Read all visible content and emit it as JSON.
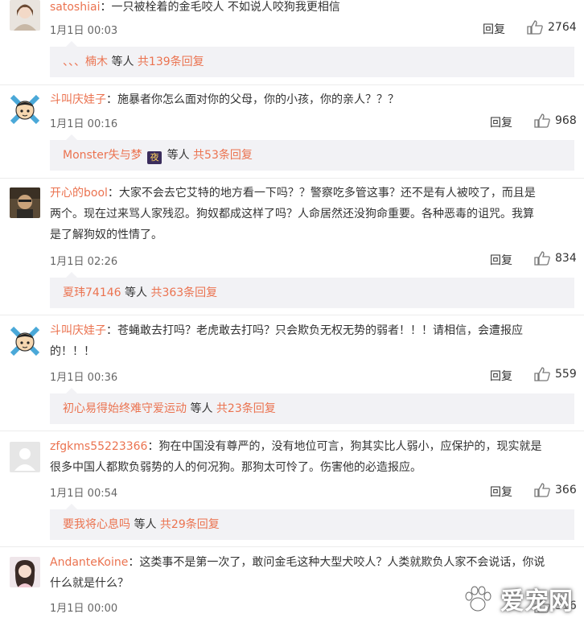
{
  "comments": [
    {
      "username": "satoshiai",
      "text": "一只被栓着的金毛咬人 不如说人咬狗我更相信",
      "time": "1月1日 00:03",
      "reply_label": "回复",
      "likes": "2764",
      "sub": {
        "user": "、、、楠木",
        "mid": "等人",
        "count": "共139条回复"
      }
    },
    {
      "username": "斗叫庆娃子",
      "text": "施暴者你怎么面对你的父母，你的小孩，你的亲人？？？",
      "time": "1月1日 00:16",
      "reply_label": "回复",
      "likes": "968",
      "sub": {
        "user": "Monster失与梦",
        "badge": "夜",
        "mid": "等人",
        "count": "共53条回复"
      }
    },
    {
      "username": "开心的bool",
      "text_lines": [
        "大家不会去它艾特的地方看一下吗？？警察吃多管这事？还不是有人被咬了，而且是",
        "两个。现在过来骂人家残忍。狗奴都成这样了吗？人命居然还没狗命重要。各种恶毒的诅咒。我算",
        "是了解狗奴的性情了。"
      ],
      "time": "1月1日 02:26",
      "reply_label": "回复",
      "likes": "834",
      "sub": {
        "user": "夏玮74146",
        "mid": "等人",
        "count": "共363条回复"
      }
    },
    {
      "username": "斗叫庆娃子",
      "text_lines": [
        "苍蝇敢去打吗？老虎敢去打吗？只会欺负无权无势的弱者！！！请相信，会遭报应",
        "的！！！"
      ],
      "time": "1月1日 00:36",
      "reply_label": "回复",
      "likes": "559",
      "sub": {
        "user": "初心易得始终难守爱运动",
        "mid": "等人",
        "count": "共23条回复"
      }
    },
    {
      "username": "zfgkms55223366",
      "text_lines": [
        "狗在中国没有尊严的，没有地位可言，狗其实比人弱小，应保护的，现实就是",
        "很多中国人都欺负弱势的人的何况狗。那狗太可怜了。伤害他的必造报应。"
      ],
      "time": "1月1日 00:54",
      "reply_label": "回复",
      "likes": "366",
      "sub": {
        "user": "要我将心息吗",
        "mid": "等人",
        "count": "共29条回复"
      }
    },
    {
      "username": "AndanteKoine",
      "text_lines": [
        "这类事不是第一次了，敢问金毛这种大型犬咬人？人类就欺负人家不会说话，你说",
        "什么就是什么？"
      ],
      "time": "1月1日 00:00",
      "reply_label": "回复",
      "likes": "316"
    }
  ],
  "colors": {
    "link": "#eb7350",
    "subbar_bg": "#f2f2f5",
    "text": "#333333"
  },
  "icons": {
    "like": "thumbs-up-icon",
    "watermark": "paw-print-icon"
  },
  "watermark": {
    "text": "爱宠网"
  }
}
